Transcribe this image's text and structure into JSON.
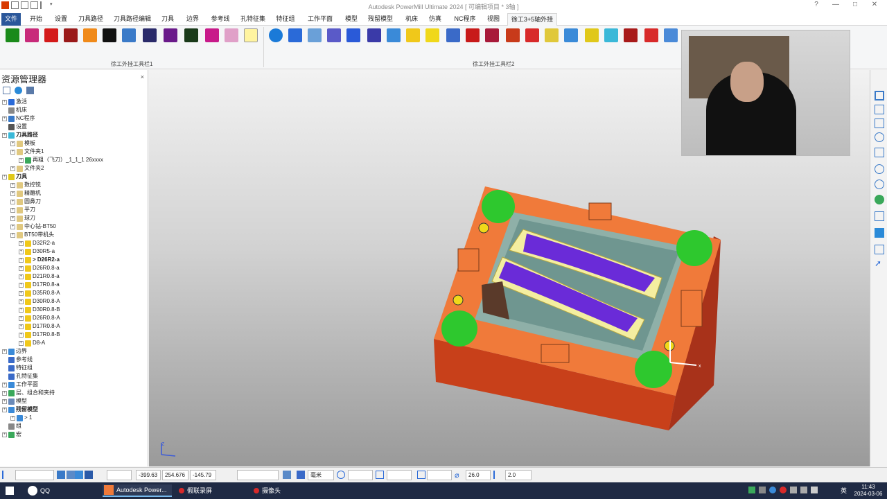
{
  "titlebar": {
    "title": "Autodesk PowerMill Ultimate 2024   [ 可编辑项目 * 3轴 ]",
    "help": "?",
    "minimize": "—",
    "maximize": "□",
    "close": "✕"
  },
  "menu": {
    "tabs": [
      "文件",
      "开始",
      "设置",
      "刀具路径",
      "刀具路径编辑",
      "刀具",
      "边界",
      "参考线",
      "孔特征集",
      "特征组",
      "工作平面",
      "模型",
      "残留模型",
      "机床",
      "仿真",
      "NC程序",
      "视图",
      "徐工3+5轴外挂"
    ]
  },
  "ribbon": {
    "group1_label": "徐工外挂工具栏1",
    "group2_label": "徐工外挂工具栏2"
  },
  "explorer": {
    "title": "资源管理器",
    "close": "×",
    "nodes": [
      {
        "label": "激活"
      },
      {
        "label": "机床"
      },
      {
        "label": "NC程序"
      },
      {
        "label": "设置"
      },
      {
        "label": "刀具路径"
      },
      {
        "label": "模板"
      },
      {
        "label": "文件夹1"
      },
      {
        "label": "再粗（飞刀）_1_1_1 26xxxx"
      },
      {
        "label": "文件夹2"
      },
      {
        "label": "刀具"
      },
      {
        "label": "数控铣"
      },
      {
        "label": "精雕机"
      },
      {
        "label": "圆鼻刀"
      },
      {
        "label": "平刀"
      },
      {
        "label": "球刀"
      },
      {
        "label": "中心钻-BT50"
      },
      {
        "label": "BT50带机头"
      },
      {
        "label": "D32R2-a"
      },
      {
        "label": "D30R5-a"
      },
      {
        "label": "> D26R2-a"
      },
      {
        "label": "D26R0.8-a"
      },
      {
        "label": "D21R0.8-a"
      },
      {
        "label": "D17R0.8-a"
      },
      {
        "label": "D35R0.8-A"
      },
      {
        "label": "D30R0.8-A"
      },
      {
        "label": "D30R0.8-B"
      },
      {
        "label": "D26R0.8-A"
      },
      {
        "label": "D17R0.8-A"
      },
      {
        "label": "D17R0.8-B"
      },
      {
        "label": "D8-A"
      },
      {
        "label": "边界"
      },
      {
        "label": "参考线"
      },
      {
        "label": "特征组"
      },
      {
        "label": "孔特征集"
      },
      {
        "label": "工作平面"
      },
      {
        "label": "层、组合和夹持"
      },
      {
        "label": "模型"
      },
      {
        "label": "残留模型"
      },
      {
        "label": "> 1"
      },
      {
        "label": "组"
      },
      {
        "label": "宏"
      }
    ]
  },
  "viewport": {
    "axis_x": "x",
    "axis_y": "Y",
    "axis_z": "Z"
  },
  "statusbar": {
    "coord_x": "-399.63",
    "coord_y": "254.676",
    "coord_z": "-145.79",
    "unit": "毫米",
    "tool_diameter": "26.0",
    "tool_value2": "2.0"
  },
  "taskbar": {
    "tasks": [
      "QQ",
      "Autodesk Power...",
      "假联录屏",
      "摄像头"
    ],
    "ime": "英",
    "time": "11:43",
    "date": "2024-03-06"
  },
  "colors": {
    "mold_orange": "#f07a3a",
    "mold_red": "#c8401a",
    "pocket_teal": "#7fa6a0",
    "surface_purple": "#6a2bd8",
    "rib_yellow": "#f4eea0",
    "marker_green": "#2ec82e",
    "file_tab_blue": "#2b579a"
  }
}
